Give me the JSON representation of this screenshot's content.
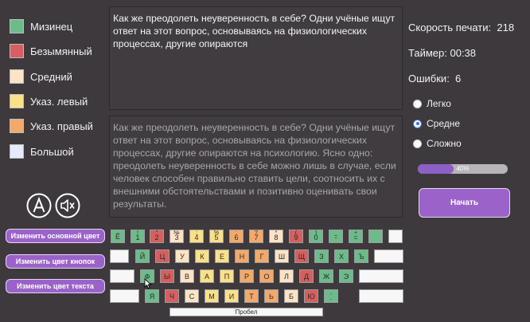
{
  "legend": [
    {
      "label": "Мизинец",
      "color": "#6dbb8b"
    },
    {
      "label": "Безымянный",
      "color": "#d65f5f"
    },
    {
      "label": "Средний",
      "color": "#fde3c6"
    },
    {
      "label": "Указ. левый",
      "color": "#fbe08a"
    },
    {
      "label": "Указ. правый",
      "color": "#f3a96a"
    },
    {
      "label": "Большой",
      "color": "#e6eaff"
    }
  ],
  "text": {
    "typed": "Как же преодолеть неуверенность в себе? Одни учёные ищут ответ на этот вопрос, основываясь на физиологических процессах, другие опираются",
    "source": "Как же преодолеть неуверенность в себе? Одни учёные ищут ответ на этот вопрос, основываясь на физиологических процессах, другие опираются на психологию. Ясно одно: преодолеть неуверенность в себе можно лишь в случае, если человек способен правильно ставить цели, соотносить их с внешними обстоятельствами и позитивно оценивать свои результаты."
  },
  "stats": {
    "speed_label": "Скорость печати:",
    "speed_value": "218",
    "timer_label": "Таймер:",
    "timer_value": "00:38",
    "errors_label": "Ошибки:",
    "errors_value": "6"
  },
  "difficulty": {
    "options": [
      "Легко",
      "Средне",
      "Сложно"
    ],
    "selected": "Средне"
  },
  "progress": {
    "percent": 40,
    "label": "40%"
  },
  "buttons": {
    "start": "Начать",
    "change_main_color": "Изменить основной цвет",
    "change_keys_color": "Изменить цвет кнопок",
    "change_text_color": "Изменить цвет текста"
  },
  "icons": {
    "accessibility": "letter-a-circle-icon",
    "sound": "speaker-mute-icon"
  },
  "keyboard": {
    "space_label": "Пробел",
    "row1": [
      {
        "top": "",
        "ch": "Ё",
        "color": "#6dbb8b"
      },
      {
        "top": "!",
        "ch": "1",
        "color": "#6dbb8b"
      },
      {
        "top": "\"",
        "ch": "2",
        "color": "#d65f5f"
      },
      {
        "top": "№",
        "ch": "3",
        "color": "#fde3c6"
      },
      {
        "top": ";",
        "ch": "4",
        "color": "#fbe08a"
      },
      {
        "top": "%",
        "ch": "5",
        "color": "#fbe08a"
      },
      {
        "top": ":",
        "ch": "6",
        "color": "#f3a96a"
      },
      {
        "top": "?",
        "ch": "7",
        "color": "#f3a96a"
      },
      {
        "top": "*",
        "ch": "8",
        "color": "#fde3c6"
      },
      {
        "top": "(",
        "ch": "9",
        "color": "#d65f5f"
      },
      {
        "top": ")",
        "ch": "0",
        "color": "#6dbb8b"
      },
      {
        "top": "_",
        "ch": "-",
        "color": "#6dbb8b"
      },
      {
        "top": "+",
        "ch": "=",
        "color": "#6dbb8b"
      },
      {
        "top": "",
        "ch": "",
        "color": "#6dbb8b"
      },
      {
        "top": "",
        "ch": "",
        "color": "#f7f7f7"
      }
    ],
    "row2": [
      {
        "ch": "",
        "color": "#f7f7f7"
      },
      {
        "ch": "Й",
        "color": "#6dbb8b"
      },
      {
        "ch": "Ц",
        "color": "#d65f5f"
      },
      {
        "ch": "У",
        "color": "#fde3c6"
      },
      {
        "ch": "К",
        "color": "#fbe08a"
      },
      {
        "ch": "Е",
        "color": "#fbe08a"
      },
      {
        "ch": "Н",
        "color": "#f3a96a"
      },
      {
        "ch": "Г",
        "color": "#f3a96a"
      },
      {
        "ch": "Ш",
        "color": "#fde3c6"
      },
      {
        "ch": "Щ",
        "color": "#d65f5f"
      },
      {
        "ch": "З",
        "color": "#6dbb8b"
      },
      {
        "ch": "Х",
        "color": "#6dbb8b"
      },
      {
        "ch": "Ъ",
        "color": "#6dbb8b"
      },
      {
        "ch": "",
        "color": "#f7f7f7"
      }
    ],
    "row3": [
      {
        "ch": "",
        "color": "#f7f7f7"
      },
      {
        "ch": "Ф",
        "color": "#6dbb8b"
      },
      {
        "ch": "Ы",
        "color": "#d65f5f"
      },
      {
        "ch": "В",
        "color": "#fde3c6"
      },
      {
        "ch": "А",
        "color": "#fbe08a"
      },
      {
        "ch": "П",
        "color": "#fbe08a"
      },
      {
        "ch": "Р",
        "color": "#f3a96a"
      },
      {
        "ch": "О",
        "color": "#f3a96a"
      },
      {
        "ch": "Л",
        "color": "#fde3c6"
      },
      {
        "ch": "Д",
        "color": "#d65f5f"
      },
      {
        "ch": "Ж",
        "color": "#6dbb8b"
      },
      {
        "ch": "Э",
        "color": "#6dbb8b"
      },
      {
        "ch": "",
        "color": "#f7f7f7"
      }
    ],
    "row4": [
      {
        "top": "",
        "ch": "",
        "color": "#f7f7f7"
      },
      {
        "top": "",
        "ch": "Я",
        "color": "#6dbb8b"
      },
      {
        "top": "",
        "ch": "Ч",
        "color": "#d65f5f"
      },
      {
        "top": "",
        "ch": "С",
        "color": "#fde3c6"
      },
      {
        "top": "",
        "ch": "М",
        "color": "#fbe08a"
      },
      {
        "top": "",
        "ch": "И",
        "color": "#fbe08a"
      },
      {
        "top": "",
        "ch": "Т",
        "color": "#f3a96a"
      },
      {
        "top": "",
        "ch": "Ь",
        "color": "#f3a96a"
      },
      {
        "top": "",
        "ch": "Б",
        "color": "#fde3c6"
      },
      {
        "top": "",
        "ch": "Ю",
        "color": "#d65f5f"
      },
      {
        "top": ",",
        "ch": ".",
        "color": "#6dbb8b"
      },
      {
        "top": "",
        "ch": "",
        "color": "#f7f7f7"
      }
    ]
  }
}
